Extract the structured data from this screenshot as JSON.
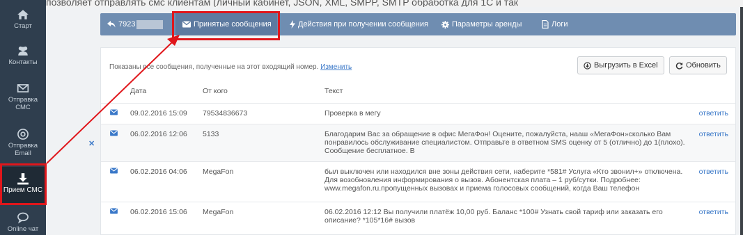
{
  "top_text": "позволяет отправлять смс клиентам (личный кабинет, JSON, XML, SMPP, SMTP обработка для 1С и так",
  "sidebar": {
    "items": [
      {
        "label": "Старт",
        "icon": "home-icon"
      },
      {
        "label": "Контакты",
        "icon": "users-icon"
      },
      {
        "label": "Отправка СМС",
        "icon": "envelope-icon"
      },
      {
        "label": "Отправка Email",
        "icon": "at-icon"
      },
      {
        "label": "Прием СМС",
        "icon": "download-icon",
        "active": true
      },
      {
        "label": "Online чат",
        "icon": "chat-icon"
      }
    ]
  },
  "nav": {
    "number": "7923",
    "tabs": [
      {
        "label": "Принятые сообщения",
        "icon": "envelope-icon",
        "active": true
      },
      {
        "label": "Действия при получении сообщения",
        "icon": "bolt-icon"
      },
      {
        "label": "Параметры аренды",
        "icon": "gear-icon"
      },
      {
        "label": "Логи",
        "icon": "file-icon"
      }
    ]
  },
  "info": {
    "text": "Показаны все сообщения, полученные на этот входящий номер.",
    "link": "Изменить"
  },
  "buttons": {
    "export": "Выгрузить в Excel",
    "refresh": "Обновить"
  },
  "table": {
    "headers": [
      "Дата",
      "От кого",
      "Текст"
    ],
    "reply_label": "ответить",
    "rows": [
      {
        "date": "09.02.2016 15:09",
        "from": "79534836673",
        "text": [
          "Проверка в мегу"
        ]
      },
      {
        "date": "06.02.2016 12:06",
        "from": "5133",
        "text": [
          "Благодарим Вас за обращение в офис МегаФон! Оцените, пожалуйста, нааш «МегаФон»сколько Вам",
          "понравилось обслуживание специалистом. Отправьте в ответном SMS оценку от 5 (отлично) до 1(плохо).",
          "Сообщение бесплатное. В"
        ]
      },
      {
        "date": "06.02.2016 04:06",
        "from": "MegaFon",
        "text": [
          "был выключен или находился вне зоны действия сети, наберите *581# Услуга «Кто звонил+» отключена.",
          "Для возобновления информирования о вызов. Абонентская плата – 1 руб/сутки. Подробнее:",
          "www.megafon.ru.пропущенных вызовах и приема голосовых сообщений, когда Ваш телефон"
        ]
      },
      {
        "date": "06.02.2016 15:06",
        "from": "MegaFon",
        "text": [
          "06.02.2016 12:12 Вы получили платёж 10,00 руб. Баланс *100# Узнать свой тариф или заказать его",
          "описание? *105*16# вызов"
        ]
      }
    ]
  },
  "colors": {
    "sidebar": "#2f3e4e",
    "navbar": "#6f8db1",
    "link": "#3a78c8",
    "highlight": "#e0161b"
  }
}
